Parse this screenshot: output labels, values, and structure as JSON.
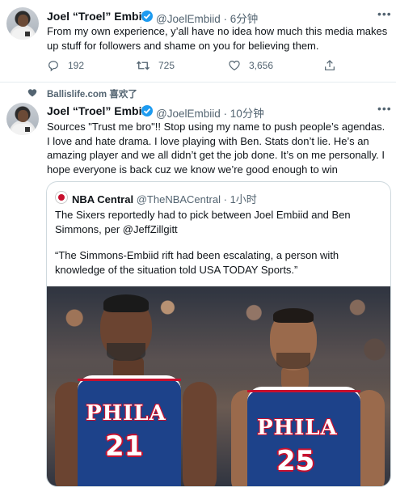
{
  "tweet1": {
    "name": "Joel “Troel” Embiid",
    "handle": "@JoelEmbiid",
    "time": "6分钟",
    "text": "From my own experience, y’all have no idea how much this media makes up stuff for followers and shame on you for believing them.",
    "replies": "192",
    "retweets": "725",
    "likes": "3,656"
  },
  "liked_by": "Ballislife.com 喜欢了",
  "tweet2": {
    "name": "Joel “Troel” Embiid",
    "handle": "@JoelEmbiid",
    "time": "10分钟",
    "text": "Sources \"Trust me bro\"!! Stop using my name to push people’s agendas. I love and hate drama. I love playing with Ben. Stats don’t lie. He’s an amazing player and we all didn’t get the job done. It’s on me personally. I hope everyone is back cuz we know we’re good enough to win"
  },
  "quote": {
    "name": "NBA Central",
    "handle": "@TheNBACentral",
    "time": "1小时",
    "text1": "The Sixers reportedly had to pick between Joel Embiid and Ben Simmons, per @JeffZillgitt",
    "text2": "“The Simmons-Embiid rift had been escalating, a person with knowledge of the situation told USA TODAY Sports.”",
    "photo": {
      "jersey_left_text": "PHILA",
      "jersey_left_number": "21",
      "jersey_right_text": "PHILA",
      "jersey_right_number": "25"
    }
  },
  "colors": {
    "verified": "#1d9bf0",
    "secondary_text": "#536471",
    "jersey_blue": "#1d428a",
    "jersey_red": "#c8102e"
  },
  "icons": {
    "reply": "reply-icon",
    "retweet": "retweet-icon",
    "like": "heart-icon",
    "share": "share-icon",
    "verified": "verified-badge-icon",
    "more": "more-icon"
  }
}
